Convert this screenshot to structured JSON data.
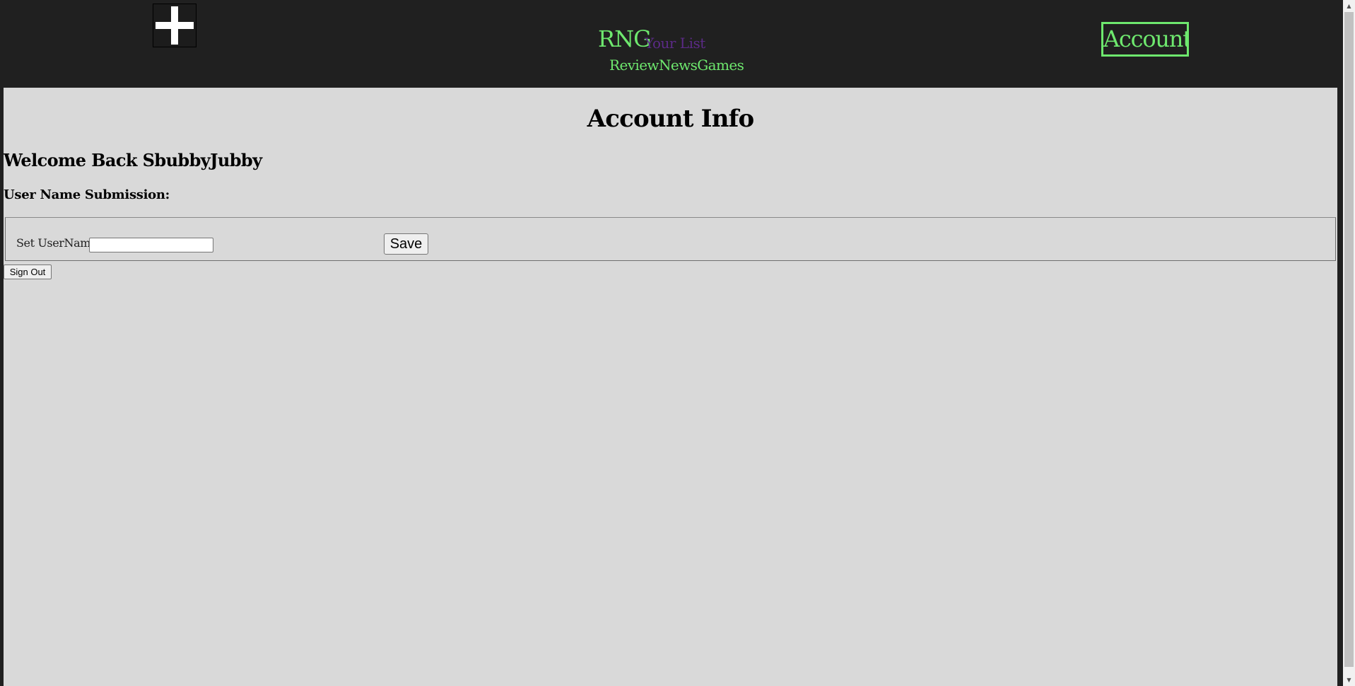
{
  "header": {
    "add_icon": "plus-icon",
    "brand": "RNG",
    "your_list": "Your List",
    "nav": [
      "Review",
      "News",
      "Games"
    ],
    "account_label": "Account"
  },
  "main": {
    "title": "Account Info",
    "welcome": "Welcome Back SbubbyJubby",
    "section_label": "User Name Submission:",
    "form": {
      "label": "Set UserName:",
      "value": "",
      "save_label": "Save"
    },
    "signout_label": "Sign Out"
  },
  "colors": {
    "header_bg": "#202020",
    "accent_green": "#6ee86e",
    "accent_purple": "#5b2a86",
    "content_bg": "#d9d9d9"
  }
}
